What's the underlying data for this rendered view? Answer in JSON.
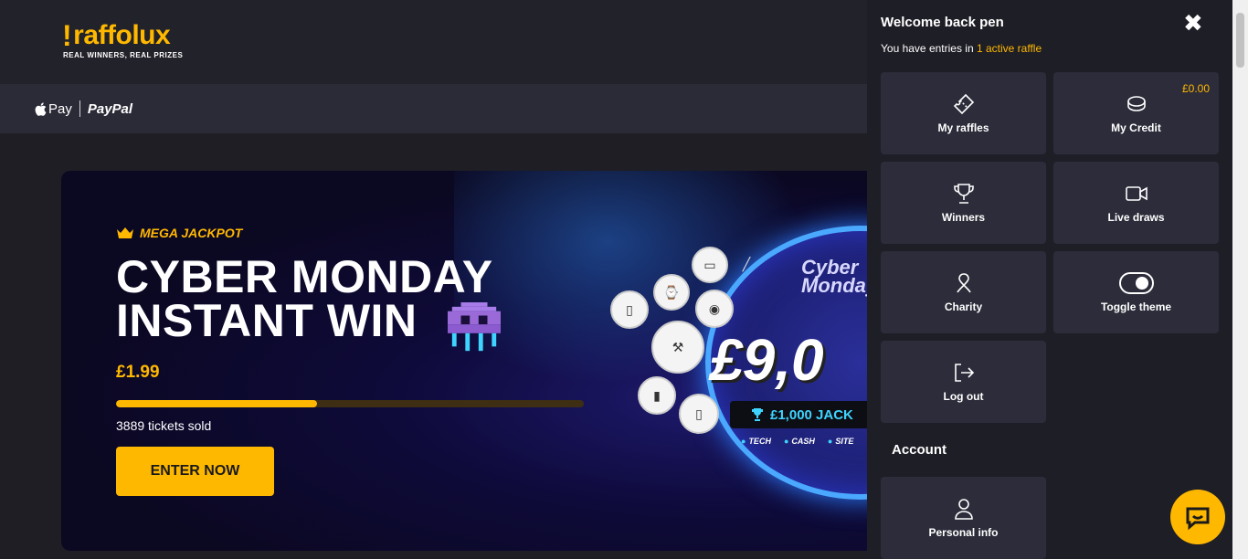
{
  "header": {
    "logo_text": "raffolux",
    "logo_tagline": "REAL WINNERS, REAL PRIZES"
  },
  "payments": {
    "apple_pay": "Pay",
    "paypal": "PayPal"
  },
  "hero": {
    "badge": "MEGA JACKPOT",
    "title_line1": "CYBER MONDAY",
    "title_line2": "INSTANT WIN",
    "price": "£1.99",
    "progress_fraction": 0.43,
    "tickets_sold": "3889 tickets sold",
    "enter_label": "ENTER NOW",
    "prize_brand": "Cyber Monday",
    "prize_amount": "£9,0",
    "jackpot_label": "£1,000 JACK",
    "tags": [
      "TECH",
      "CASH",
      "SITE"
    ]
  },
  "panel": {
    "welcome": "Welcome back pen",
    "entries_prefix": "You have entries in ",
    "entries_link": "1 active raffle",
    "tiles": {
      "my_raffles": "My raffles",
      "my_credit": "My Credit",
      "credit_amount": "£0.00",
      "winners": "Winners",
      "live_draws": "Live draws",
      "charity": "Charity",
      "toggle_theme": "Toggle theme",
      "log_out": "Log out",
      "personal_info": "Personal info"
    },
    "account_heading": "Account"
  },
  "colors": {
    "accent": "#ffb800",
    "panel_bg": "#1e1e26",
    "tile_bg": "#2c2c3a"
  }
}
